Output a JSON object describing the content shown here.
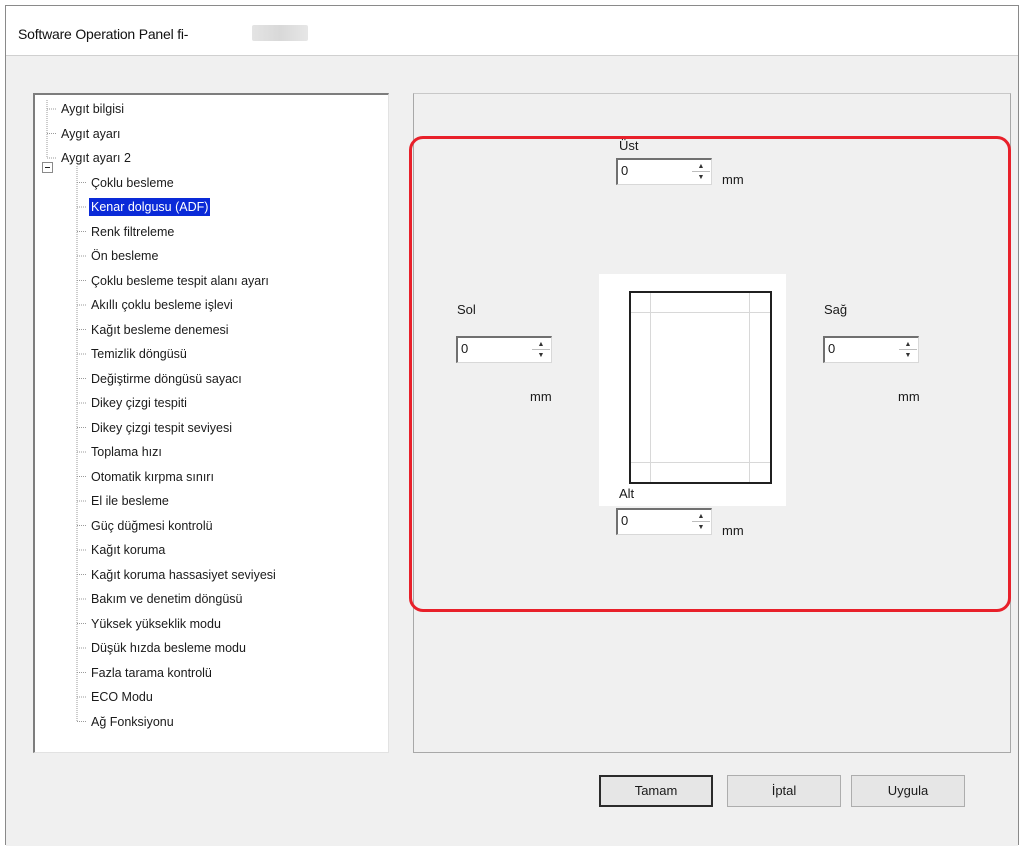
{
  "window": {
    "title": "Software Operation Panel fi-"
  },
  "tree": {
    "items": [
      {
        "label": "Aygıt bilgisi",
        "level": 0
      },
      {
        "label": "Aygıt ayarı",
        "level": 0
      },
      {
        "label": "Aygıt ayarı 2",
        "level": 0,
        "expanded": true
      },
      {
        "label": "Çoklu besleme",
        "level": 1
      },
      {
        "label": "Kenar dolgusu (ADF)",
        "level": 1,
        "selected": true
      },
      {
        "label": "Renk filtreleme",
        "level": 1
      },
      {
        "label": "Ön besleme",
        "level": 1
      },
      {
        "label": "Çoklu besleme tespit alanı ayarı",
        "level": 1
      },
      {
        "label": "Akıllı çoklu besleme işlevi",
        "level": 1
      },
      {
        "label": "Kağıt besleme denemesi",
        "level": 1
      },
      {
        "label": "Temizlik döngüsü",
        "level": 1
      },
      {
        "label": "Değiştirme döngüsü sayacı",
        "level": 1
      },
      {
        "label": "Dikey çizgi tespiti",
        "level": 1
      },
      {
        "label": "Dikey çizgi tespit seviyesi",
        "level": 1
      },
      {
        "label": "Toplama hızı",
        "level": 1
      },
      {
        "label": "Otomatik kırpma sınırı",
        "level": 1
      },
      {
        "label": "El ile besleme",
        "level": 1
      },
      {
        "label": "Güç düğmesi kontrolü",
        "level": 1
      },
      {
        "label": "Kağıt koruma",
        "level": 1
      },
      {
        "label": "Kağıt koruma hassasiyet seviyesi",
        "level": 1
      },
      {
        "label": "Bakım ve denetim döngüsü",
        "level": 1
      },
      {
        "label": "Yüksek yükseklik modu",
        "level": 1
      },
      {
        "label": "Düşük hızda besleme modu",
        "level": 1
      },
      {
        "label": "Fazla tarama kontrolü",
        "level": 1
      },
      {
        "label": "ECO Modu",
        "level": 1
      },
      {
        "label": "Ağ Fonksiyonu",
        "level": 1
      }
    ]
  },
  "margins": {
    "top": {
      "label": "Üst",
      "value": "0",
      "unit": "mm"
    },
    "left": {
      "label": "Sol",
      "value": "0",
      "unit": "mm"
    },
    "right": {
      "label": "Sağ",
      "value": "0",
      "unit": "mm"
    },
    "bottom": {
      "label": "Alt",
      "value": "0",
      "unit": "mm"
    }
  },
  "buttons": {
    "ok": "Tamam",
    "cancel": "İptal",
    "apply": "Uygula"
  },
  "colors": {
    "highlight": "#e8202a",
    "selection": "#0a2ad8"
  }
}
